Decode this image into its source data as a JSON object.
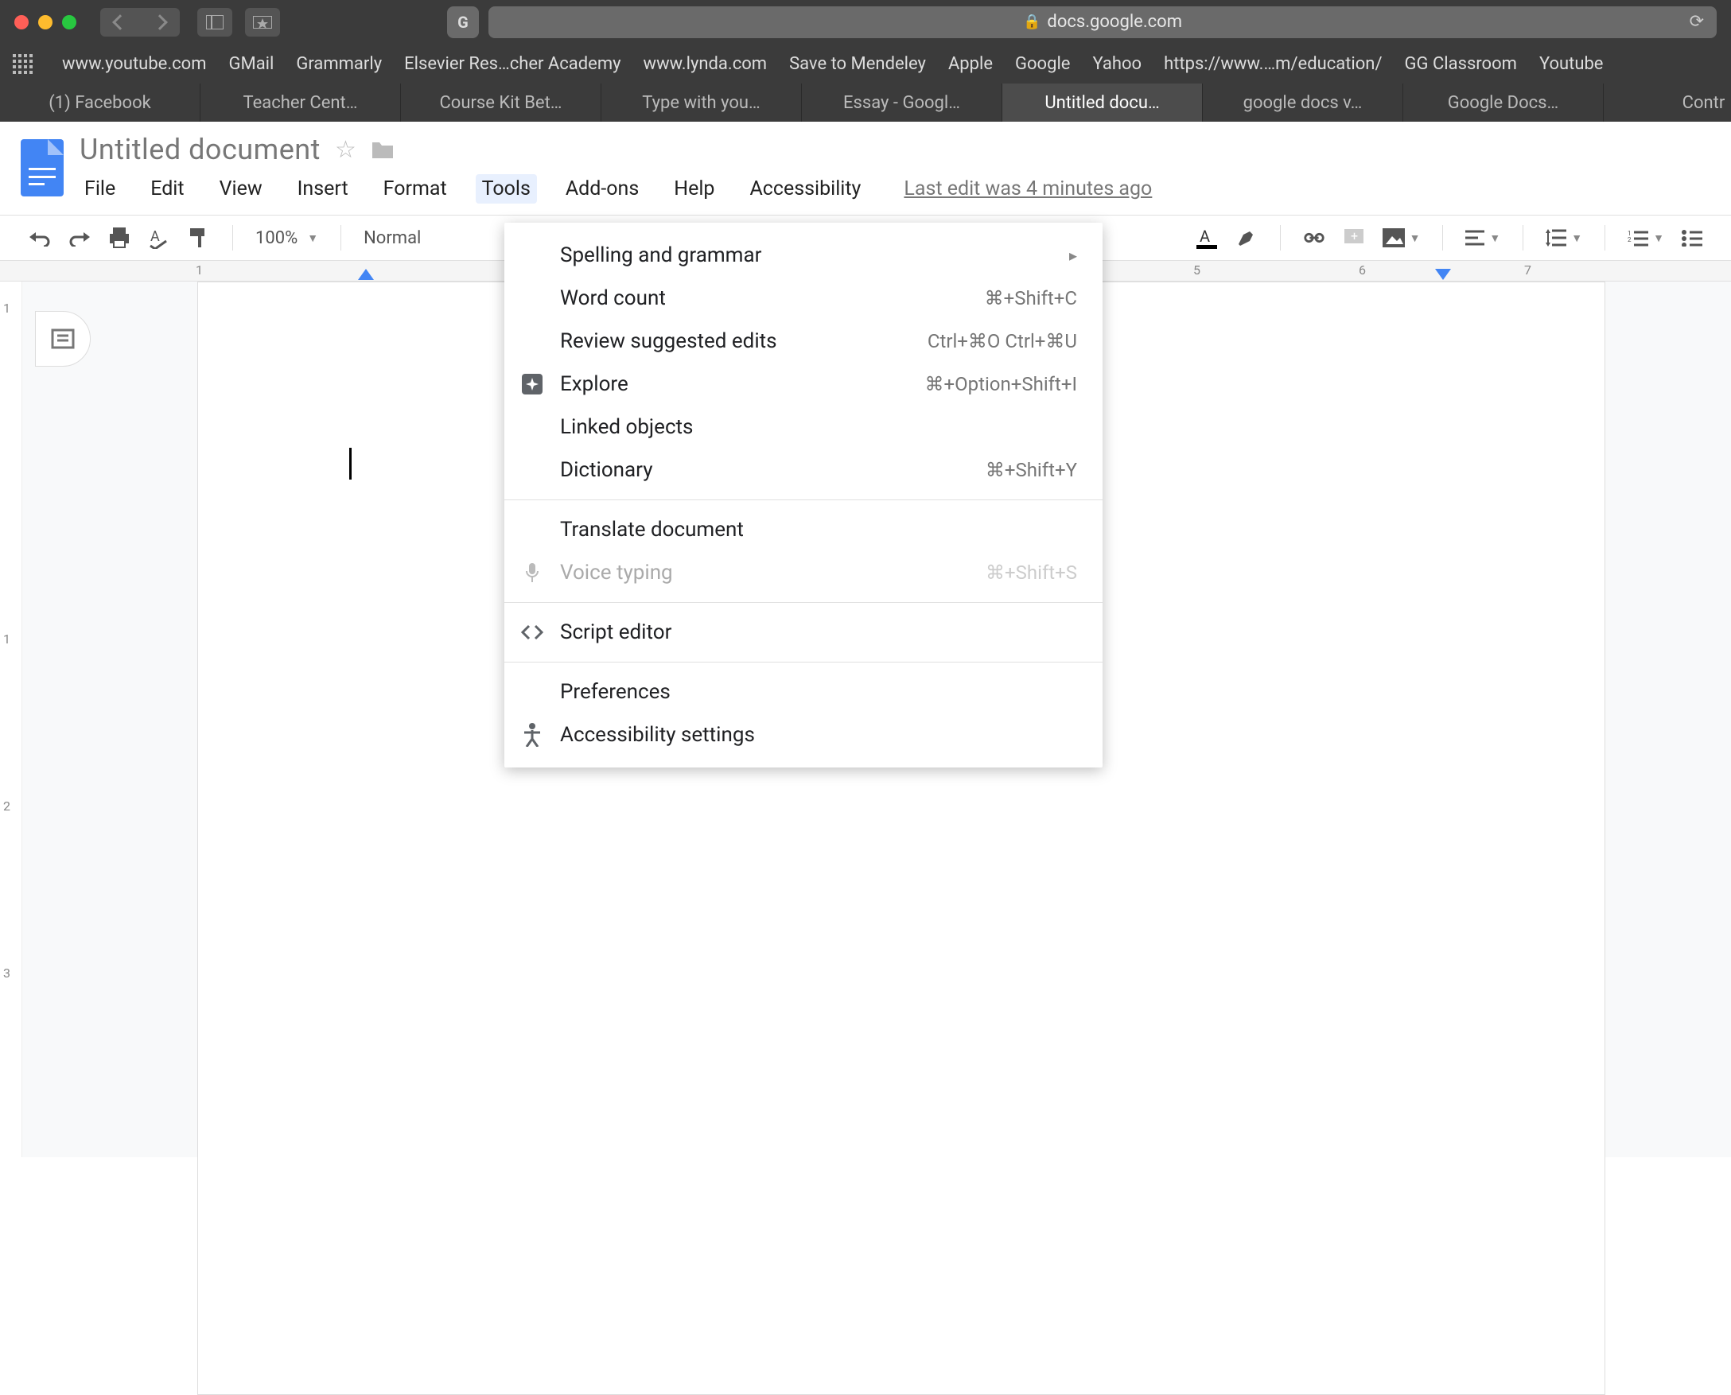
{
  "browser": {
    "url_display": "docs.google.com",
    "g_button": "G",
    "bookmarks": [
      "www.youtube.com",
      "GMail",
      "Grammarly",
      "Elsevier Res…cher Academy",
      "www.lynda.com",
      "Save to Mendeley",
      "Apple",
      "Google",
      "Yahoo",
      "https://www.…m/education/",
      "GG Classroom",
      "Youtube"
    ],
    "tabs": [
      {
        "label": "(1) Facebook",
        "active": false
      },
      {
        "label": "Teacher Cent…",
        "active": false
      },
      {
        "label": "Course Kit Bet…",
        "active": false
      },
      {
        "label": "Type with you…",
        "active": false
      },
      {
        "label": "Essay - Googl…",
        "active": false
      },
      {
        "label": "Untitled docu…",
        "active": true
      },
      {
        "label": "google docs v…",
        "active": false
      },
      {
        "label": "Google Docs…",
        "active": false
      },
      {
        "label": "Contr",
        "active": false
      }
    ]
  },
  "docs": {
    "title": "Untitled document",
    "menus": [
      "File",
      "Edit",
      "View",
      "Insert",
      "Format",
      "Tools",
      "Add-ons",
      "Help",
      "Accessibility"
    ],
    "open_menu_index": 5,
    "last_edit": "Last edit was 4 minutes ago",
    "toolbar": {
      "zoom": "100%",
      "style": "Normal"
    },
    "ruler": {
      "visible_numbers": [
        "1",
        "5",
        "6",
        "7"
      ]
    },
    "vruler": {
      "numbers": [
        "1",
        "1",
        "2",
        "3"
      ]
    }
  },
  "tools_menu": {
    "items": [
      {
        "label": "Spelling and grammar",
        "submenu": true
      },
      {
        "label": "Word count",
        "shortcut": "⌘+Shift+C"
      },
      {
        "label": "Review suggested edits",
        "shortcut": "Ctrl+⌘O Ctrl+⌘U"
      },
      {
        "label": "Explore",
        "shortcut": "⌘+Option+Shift+I",
        "icon": "explore"
      },
      {
        "label": "Linked objects"
      },
      {
        "label": "Dictionary",
        "shortcut": "⌘+Shift+Y"
      },
      {
        "sep": true
      },
      {
        "label": "Translate document"
      },
      {
        "label": "Voice typing",
        "shortcut": "⌘+Shift+S",
        "icon": "mic",
        "disabled": true
      },
      {
        "sep": true
      },
      {
        "label": "Script editor",
        "icon": "code"
      },
      {
        "sep": true
      },
      {
        "label": "Preferences"
      },
      {
        "label": "Accessibility settings",
        "icon": "accessibility"
      }
    ]
  }
}
